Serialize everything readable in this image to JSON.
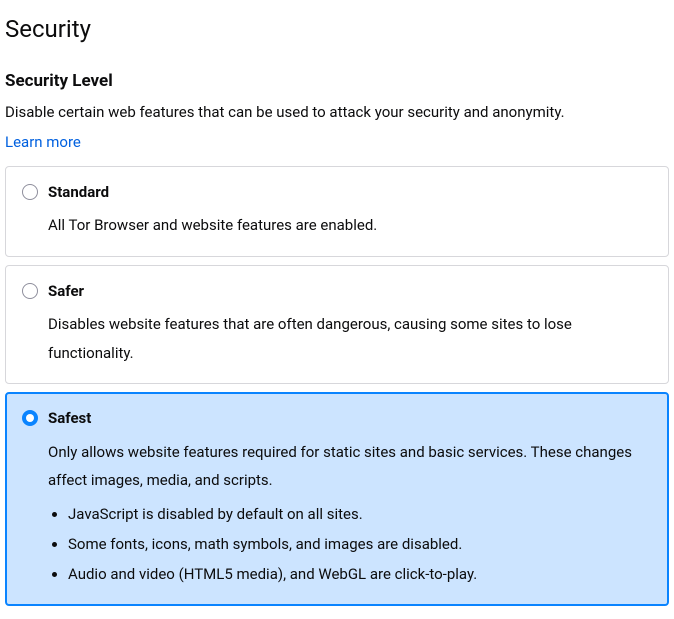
{
  "page": {
    "title": "Security"
  },
  "section": {
    "heading": "Security Level",
    "subtitle": "Disable certain web features that can be used to attack your security and anonymity.",
    "learn_more": "Learn more"
  },
  "options": {
    "standard": {
      "title": "Standard",
      "desc": "All Tor Browser and website features are enabled.",
      "selected": false
    },
    "safer": {
      "title": "Safer",
      "desc": "Disables website features that are often dangerous, causing some sites to lose functionality.",
      "selected": false
    },
    "safest": {
      "title": "Safest",
      "desc": "Only allows website features required for static sites and basic services. These changes affect images, media, and scripts.",
      "selected": true,
      "bullets": [
        "JavaScript is disabled by default on all sites.",
        "Some fonts, icons, math symbols, and images are disabled.",
        "Audio and video (HTML5 media), and WebGL are click-to-play."
      ]
    }
  }
}
